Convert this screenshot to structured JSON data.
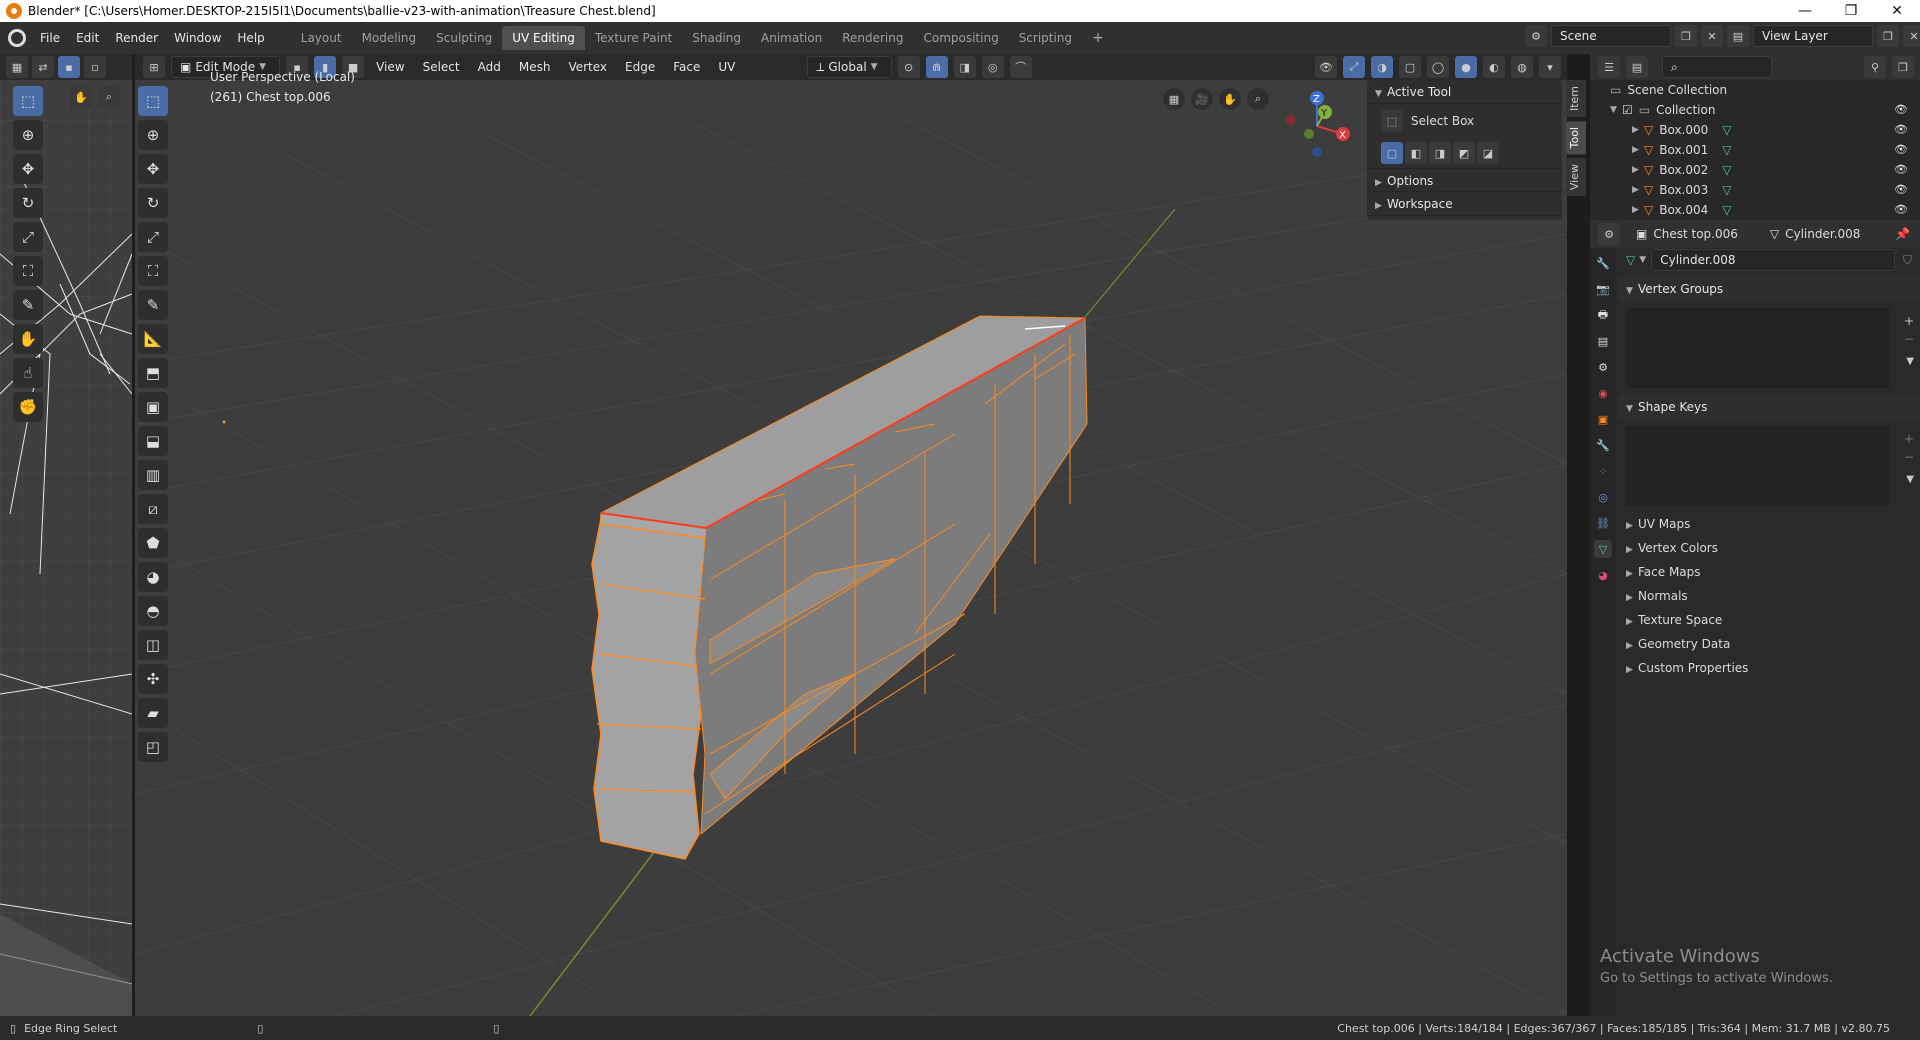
{
  "window": {
    "title": "Blender* [C:\\Users\\Homer.DESKTOP-215I5I1\\Documents\\ballie-v23-with-animation\\Treasure Chest.blend]",
    "minimize": "—",
    "restore": "❐",
    "close": "✕"
  },
  "menu": [
    "File",
    "Edit",
    "Render",
    "Window",
    "Help"
  ],
  "workspaces": [
    "Layout",
    "Modeling",
    "Sculpting",
    "UV Editing",
    "Texture Paint",
    "Shading",
    "Animation",
    "Rendering",
    "Compositing",
    "Scripting",
    "+"
  ],
  "active_workspace": "UV Editing",
  "scene": {
    "name": "Scene",
    "view_layer": "View Layer"
  },
  "viewport": {
    "mode": "Edit Mode",
    "menus": [
      "View",
      "Select",
      "Add",
      "Mesh",
      "Vertex",
      "Edge",
      "Face",
      "UV"
    ],
    "orientation": "Global",
    "perspective_label": "User Perspective (Local)",
    "object_label": "(261) Chest top.006",
    "gizmo": {
      "x": "X",
      "y": "Y",
      "z": "Z"
    }
  },
  "npanel": {
    "active_tool_header": "Active Tool",
    "tool_name": "Select Box",
    "options": "Options",
    "workspace": "Workspace",
    "tabs": [
      "Item",
      "Tool",
      "View"
    ]
  },
  "outliner": {
    "root": "Scene Collection",
    "collection": "Collection",
    "items": [
      "Box.000",
      "Box.001",
      "Box.002",
      "Box.003",
      "Box.004"
    ]
  },
  "properties": {
    "object_name": "Chest top.006",
    "mesh_name": "Cylinder.008",
    "datablock": "Cylinder.008",
    "sections_open": [
      "Vertex Groups",
      "Shape Keys"
    ],
    "sections_closed": [
      "UV Maps",
      "Vertex Colors",
      "Face Maps",
      "Normals",
      "Texture Space",
      "Geometry Data",
      "Custom Properties"
    ]
  },
  "status": {
    "left": "Edge Ring Select",
    "stats": "Chest top.006 | Verts:184/184 | Edges:367/367 | Faces:185/185 | Tris:364 | Mem: 31.7 MB | v2.80.75"
  },
  "watermark": {
    "line1": "Activate Windows",
    "line2": "Go to Settings to activate Windows."
  },
  "colors": {
    "accent": "#4a6da7",
    "selection": "#ff8a1c",
    "grid": "#474747",
    "y_axis": "#6e8e2e"
  }
}
